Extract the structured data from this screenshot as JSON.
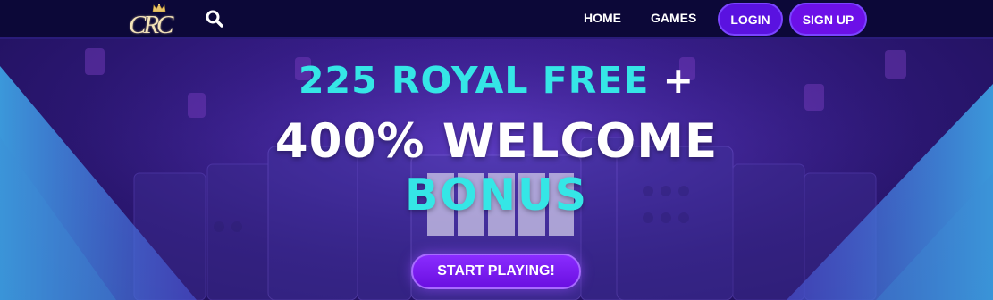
{
  "header": {
    "logo_text": "CRC",
    "search_icon": "search-icon",
    "nav": {
      "home": "HOME",
      "games": "GAMES"
    },
    "login_label": "LOGIN",
    "signup_label": "SIGN UP"
  },
  "hero": {
    "line1_accent": "225 ROYAL FREE",
    "line1_plus": " +",
    "line2": "400% WELCOME",
    "line3": "BONUS",
    "cta_label": "START PLAYING!"
  },
  "colors": {
    "header_bg": "#0c0838",
    "accent_cyan": "#35e6e6",
    "button_purple": "#6c10e8",
    "hero_purple": "#3a1f8e",
    "side_blue": "#3aa6e0"
  }
}
